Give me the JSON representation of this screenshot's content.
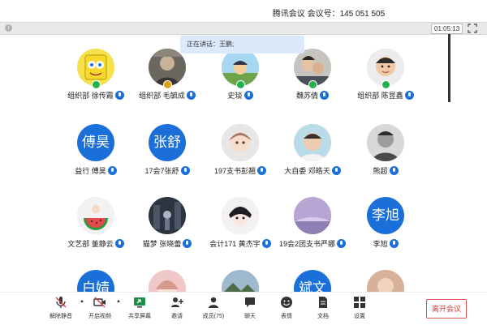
{
  "window": {
    "title": "腾讯会议  会议号：145 051 505",
    "timer": "01:05:13"
  },
  "speaking": "正在讲话：王鹏;",
  "participants": [
    {
      "name": "组织部 徐传霞",
      "avatar": "sponge",
      "avatar_text": "",
      "badge": "host"
    },
    {
      "name": "组织部 毛毓成",
      "avatar": "photo-dark",
      "avatar_text": "",
      "badge": "cohost"
    },
    {
      "name": "史琰",
      "avatar": "photo-sky",
      "avatar_text": "",
      "badge": "host"
    },
    {
      "name": "魏苏倩",
      "avatar": "photo-people",
      "avatar_text": "",
      "badge": "host"
    },
    {
      "name": "组织部 陈昱鑫",
      "avatar": "photo-child",
      "avatar_text": "",
      "badge": "host"
    },
    {
      "name": "益行  傅昊",
      "avatar": "text",
      "avatar_text": "傅昊",
      "badge": ""
    },
    {
      "name": "17会7张舒",
      "avatar": "text",
      "avatar_text": "张舒",
      "badge": ""
    },
    {
      "name": "197支书彭翘",
      "avatar": "photo-anime",
      "avatar_text": "",
      "badge": ""
    },
    {
      "name": "大自委 邓皓天",
      "avatar": "photo-boy",
      "avatar_text": "",
      "badge": ""
    },
    {
      "name": "熊超",
      "avatar": "photo-bw",
      "avatar_text": "",
      "badge": ""
    },
    {
      "name": "文艺部 董静云",
      "avatar": "photo-melon",
      "avatar_text": "",
      "badge": ""
    },
    {
      "name": "猫梦  张晓蕾",
      "avatar": "photo-night",
      "avatar_text": "",
      "badge": ""
    },
    {
      "name": "会计171 黄杰宇",
      "avatar": "photo-anime2",
      "avatar_text": "",
      "badge": ""
    },
    {
      "name": "19会2团支书严娜",
      "avatar": "photo-purple",
      "avatar_text": "",
      "badge": ""
    },
    {
      "name": "李旭",
      "avatar": "text",
      "avatar_text": "李旭",
      "badge": ""
    },
    {
      "name": "",
      "avatar": "text",
      "avatar_text": "白婧",
      "badge": ""
    },
    {
      "name": "",
      "avatar": "photo-pink",
      "avatar_text": "",
      "badge": ""
    },
    {
      "name": "",
      "avatar": "photo-landscape",
      "avatar_text": "",
      "badge": ""
    },
    {
      "name": "",
      "avatar": "text",
      "avatar_text": "斌文",
      "badge": ""
    },
    {
      "name": "",
      "avatar": "photo-warm",
      "avatar_text": "",
      "badge": ""
    }
  ],
  "toolbar": {
    "mute": "解除静音",
    "video": "开启视频",
    "share": "共享屏幕",
    "invite": "邀请",
    "members": "成员(75)",
    "chat": "聊天",
    "emoji": "表情",
    "docs": "文档",
    "settings": "设置",
    "leave": "离开会议"
  },
  "colors": {
    "accent": "#1a6fd8",
    "leave": "#d93737",
    "host_badge": "#23b14d"
  }
}
